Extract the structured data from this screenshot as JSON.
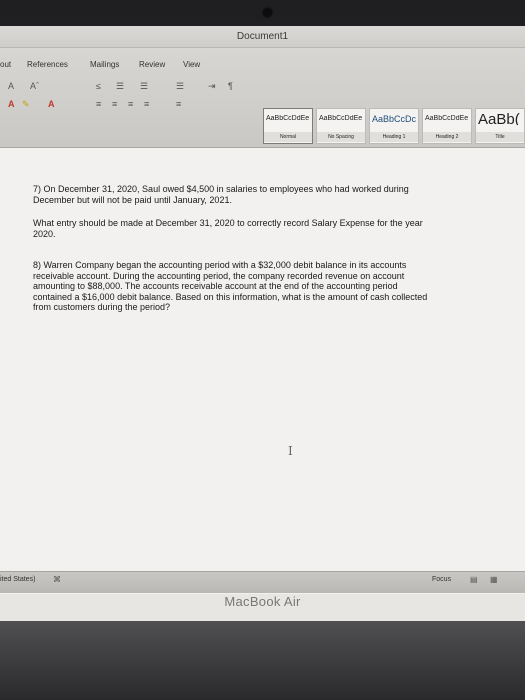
{
  "window": {
    "title": "Document1"
  },
  "ribbon": {
    "tabs": [
      "out",
      "References",
      "Mailings",
      "Review",
      "View"
    ],
    "styles": [
      {
        "sample": "AaBbCcDdEe",
        "name": "Normal"
      },
      {
        "sample": "AaBbCcDdEe",
        "name": "No Spacing"
      },
      {
        "sample": "AaBbCcDc",
        "name": "Heading 1"
      },
      {
        "sample": "AaBbCcDdEe",
        "name": "Heading 2"
      },
      {
        "sample": "AaBb(",
        "name": "Title"
      }
    ],
    "tools_row1": [
      "A",
      "Aˆ",
      "≤",
      "☰",
      "☰",
      "☰",
      "⇥",
      "¶"
    ],
    "tools_row2": [
      "A",
      "✎",
      "A",
      "≡",
      "≡",
      "≡",
      "≡",
      "≡"
    ]
  },
  "document": {
    "q7_line1": "7) On December 31, 2020, Saul owed $4,500 in salaries to employees who had worked during",
    "q7_line2": "December but will not be paid until January, 2021.",
    "q7_question_line1": "What entry should be made at December 31, 2020 to correctly record Salary Expense for the year",
    "q7_question_line2": "2020.",
    "q8_lines": [
      "8) Warren Company began the accounting period with a $32,000 debit balance in its accounts",
      "receivable account. During the accounting period, the company recorded revenue on account",
      "amounting to $88,000. The accounts receivable account at the end of the accounting period",
      "contained a $16,000 debit balance. Based on this information, what is the amount of cash collected",
      "from customers during the period?"
    ]
  },
  "status": {
    "language": "ited States)",
    "focus": "Focus"
  },
  "device": {
    "brand": "MacBook Air"
  }
}
